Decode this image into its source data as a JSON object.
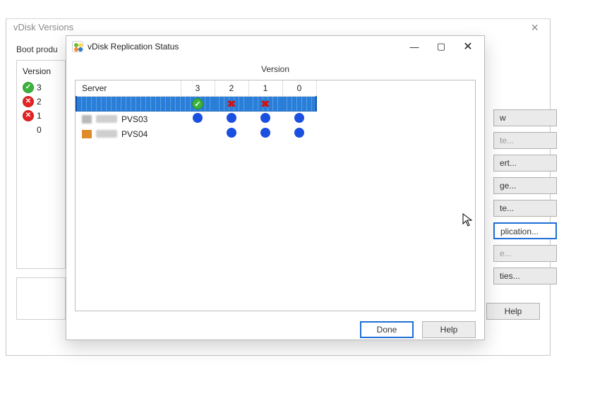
{
  "outer": {
    "title": "vDisk Versions",
    "boot_label": "Boot produ",
    "version_header": "Version",
    "versions": [
      {
        "num": "3",
        "status": "ok"
      },
      {
        "num": "2",
        "status": "err"
      },
      {
        "num": "1",
        "status": "err"
      },
      {
        "num": "0",
        "status": "none"
      }
    ],
    "side_buttons": [
      {
        "label": "w",
        "state": "normal"
      },
      {
        "label": "te...",
        "state": "disabled"
      },
      {
        "label": "ert...",
        "state": "normal"
      },
      {
        "label": "ge...",
        "state": "normal"
      },
      {
        "label": "te...",
        "state": "normal"
      },
      {
        "label": "plication...",
        "state": "selected"
      },
      {
        "label": "e...",
        "state": "disabled"
      },
      {
        "label": "ties...",
        "state": "normal"
      }
    ],
    "footer_help": "Help"
  },
  "dlg": {
    "title": "vDisk Replication Status",
    "section": "Version",
    "columns": {
      "server": "Server",
      "versions": [
        "3",
        "2",
        "1",
        "0"
      ]
    },
    "rows": [
      {
        "selected": true,
        "icon": "",
        "name_txt": "",
        "name_tail": "",
        "cells": [
          "ok",
          "err",
          "err",
          ""
        ]
      },
      {
        "selected": false,
        "icon": "gray",
        "name_txt": "blur",
        "name_tail": "PVS03",
        "cells": [
          "dot",
          "dot",
          "dot",
          "dot"
        ]
      },
      {
        "selected": false,
        "icon": "orange",
        "name_txt": "blur",
        "name_tail": "PVS04",
        "cells": [
          "",
          "dot",
          "dot",
          "dot"
        ]
      }
    ],
    "done": "Done",
    "help": "Help"
  }
}
